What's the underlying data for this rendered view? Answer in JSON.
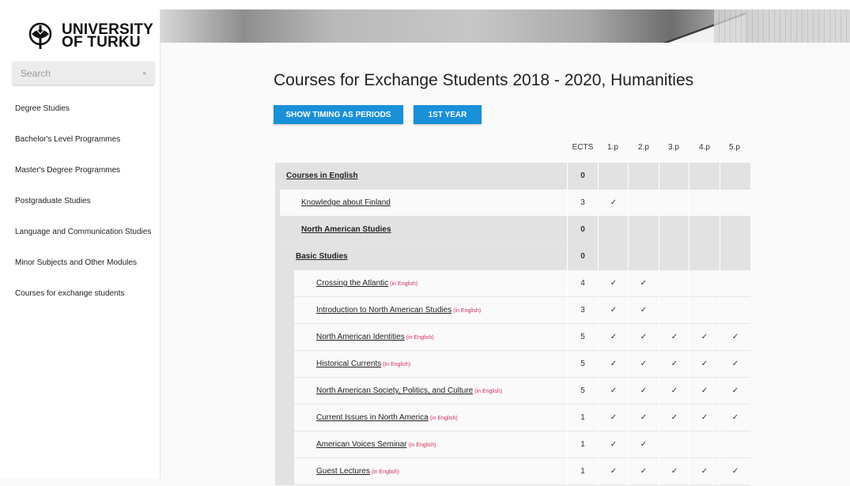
{
  "logo": {
    "line1": "UNIVERSITY",
    "line2": "OF TURKU"
  },
  "search": {
    "placeholder": "Search",
    "icon": "search-icon"
  },
  "sidebar": {
    "items": [
      {
        "label": "Degree Studies"
      },
      {
        "label": "Bachelor's Level Programmes"
      },
      {
        "label": "Master's Degree Programmes"
      },
      {
        "label": "Postgraduate Studies"
      },
      {
        "label": "Language and Communication Studies"
      },
      {
        "label": "Minor Subjects and Other Modules"
      },
      {
        "label": "Courses for exchange students"
      }
    ]
  },
  "page": {
    "title": "Courses for Exchange Students 2018 - 2020, Humanities"
  },
  "buttons": {
    "timing": "SHOW TIMING AS PERIODS",
    "year": "1ST YEAR"
  },
  "table": {
    "columns": [
      "ECTS",
      "1.p",
      "2.p",
      "3.p",
      "4.p",
      "5.p"
    ],
    "check_glyph": "✓",
    "lang_tag": "(in English)",
    "rows": [
      {
        "type": "group",
        "level": 0,
        "name": "Courses in English",
        "ects": "0",
        "periods": [
          false,
          false,
          false,
          false,
          false
        ],
        "lang": false
      },
      {
        "type": "item",
        "level": 1,
        "name": "Knowledge about Finland",
        "ects": "3",
        "periods": [
          true,
          false,
          false,
          false,
          false
        ],
        "lang": false
      },
      {
        "type": "group",
        "level": 1,
        "name": "North American Studies",
        "ects": "0",
        "periods": [
          false,
          false,
          false,
          false,
          false
        ],
        "lang": false
      },
      {
        "type": "group",
        "level": 2,
        "name": "Basic Studies",
        "ects": "0",
        "periods": [
          false,
          false,
          false,
          false,
          false
        ],
        "lang": false
      },
      {
        "type": "item",
        "level": 3,
        "name": "Crossing the Atlantic",
        "ects": "4",
        "periods": [
          true,
          true,
          false,
          false,
          false
        ],
        "lang": true
      },
      {
        "type": "item",
        "level": 3,
        "name": "Introduction to North American Studies",
        "ects": "3",
        "periods": [
          true,
          true,
          false,
          false,
          false
        ],
        "lang": true
      },
      {
        "type": "item",
        "level": 3,
        "name": "North American Identities",
        "ects": "5",
        "periods": [
          true,
          true,
          true,
          true,
          true
        ],
        "lang": true
      },
      {
        "type": "item",
        "level": 3,
        "name": "Historical Currents",
        "ects": "5",
        "periods": [
          true,
          true,
          true,
          true,
          true
        ],
        "lang": true
      },
      {
        "type": "item",
        "level": 3,
        "name": "North American Society, Politics, and Culture",
        "ects": "5",
        "periods": [
          true,
          true,
          true,
          true,
          true
        ],
        "lang": true
      },
      {
        "type": "item",
        "level": 3,
        "name": "Current Issues in North America",
        "ects": "1",
        "periods": [
          true,
          true,
          true,
          true,
          true
        ],
        "lang": true
      },
      {
        "type": "item",
        "level": 3,
        "name": "American Voices Seminar",
        "ects": "1",
        "periods": [
          true,
          true,
          false,
          false,
          false
        ],
        "lang": true
      },
      {
        "type": "item",
        "level": 3,
        "name": "Guest Lectures",
        "ects": "1",
        "periods": [
          true,
          true,
          true,
          true,
          true
        ],
        "lang": true
      }
    ]
  },
  "colors": {
    "accent": "#1a90d9",
    "lang_tag": "#d0305a",
    "group_bg": "#e2e2e2"
  }
}
